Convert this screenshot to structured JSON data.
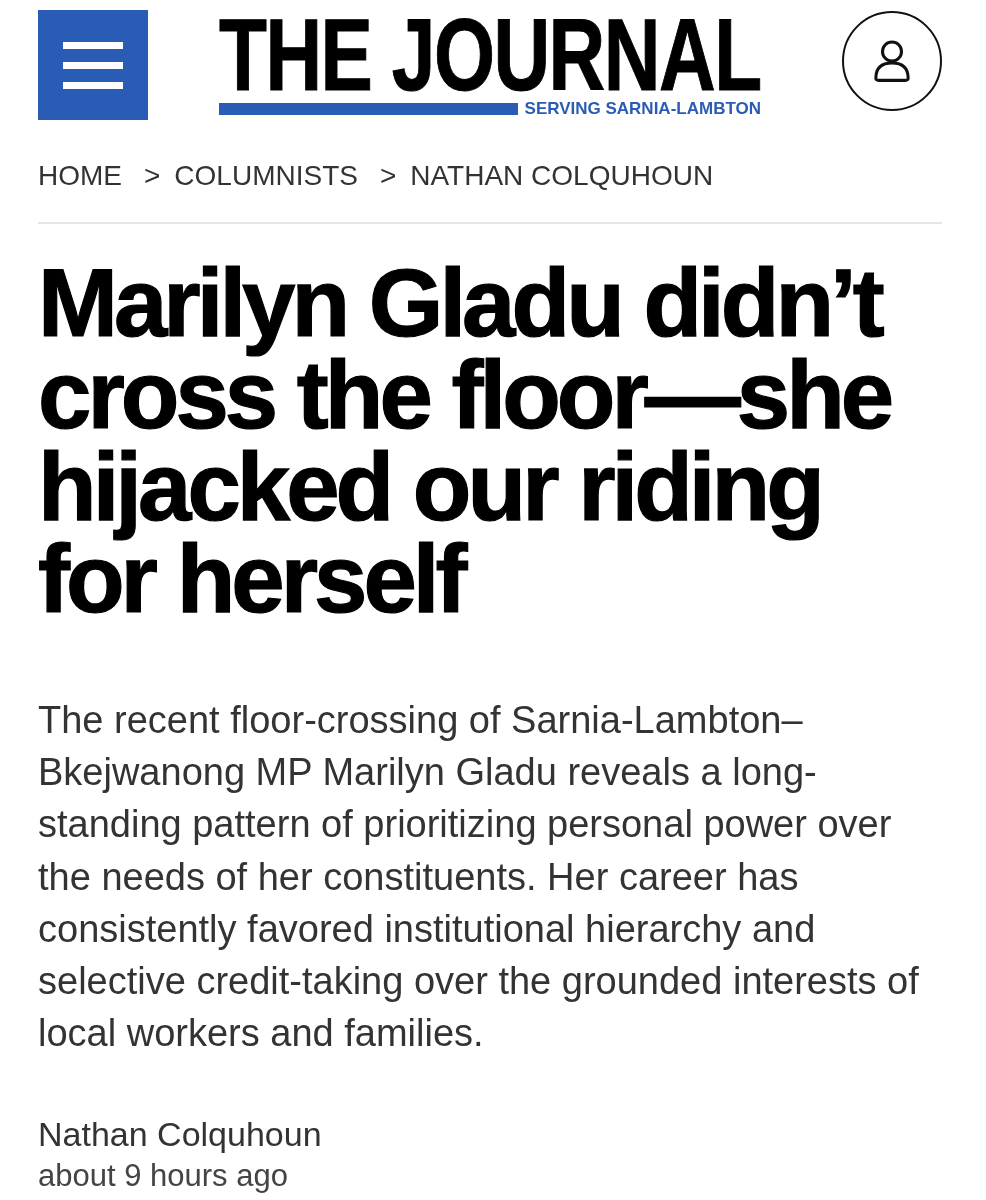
{
  "header": {
    "logo": {
      "title": "THE JOURNAL",
      "tagline": "SERVING SARNIA-LAMBTON"
    }
  },
  "breadcrumb": [
    {
      "kind": "link",
      "text": "HOME"
    },
    {
      "kind": "separator",
      "text": ">"
    },
    {
      "kind": "link",
      "text": "COLUMNISTS"
    },
    {
      "kind": "separator",
      "text": ">"
    },
    {
      "kind": "link",
      "text": "NATHAN COLQUHOUN"
    }
  ],
  "article": {
    "headline": "Marilyn Gladu didn’t cross the floor—she hijacked our riding for herself",
    "summary": "The recent floor-crossing of Sarnia-Lambton–Bkejwanong MP Marilyn Gladu reveals a long-standing pattern of prioritizing personal power over the needs of her constituents. Her career has consistently favored institutional hierarchy and selective credit-taking over the grounded interests of local workers and families.",
    "author": "Nathan Colquhoun",
    "published": "about 9 hours ago"
  }
}
